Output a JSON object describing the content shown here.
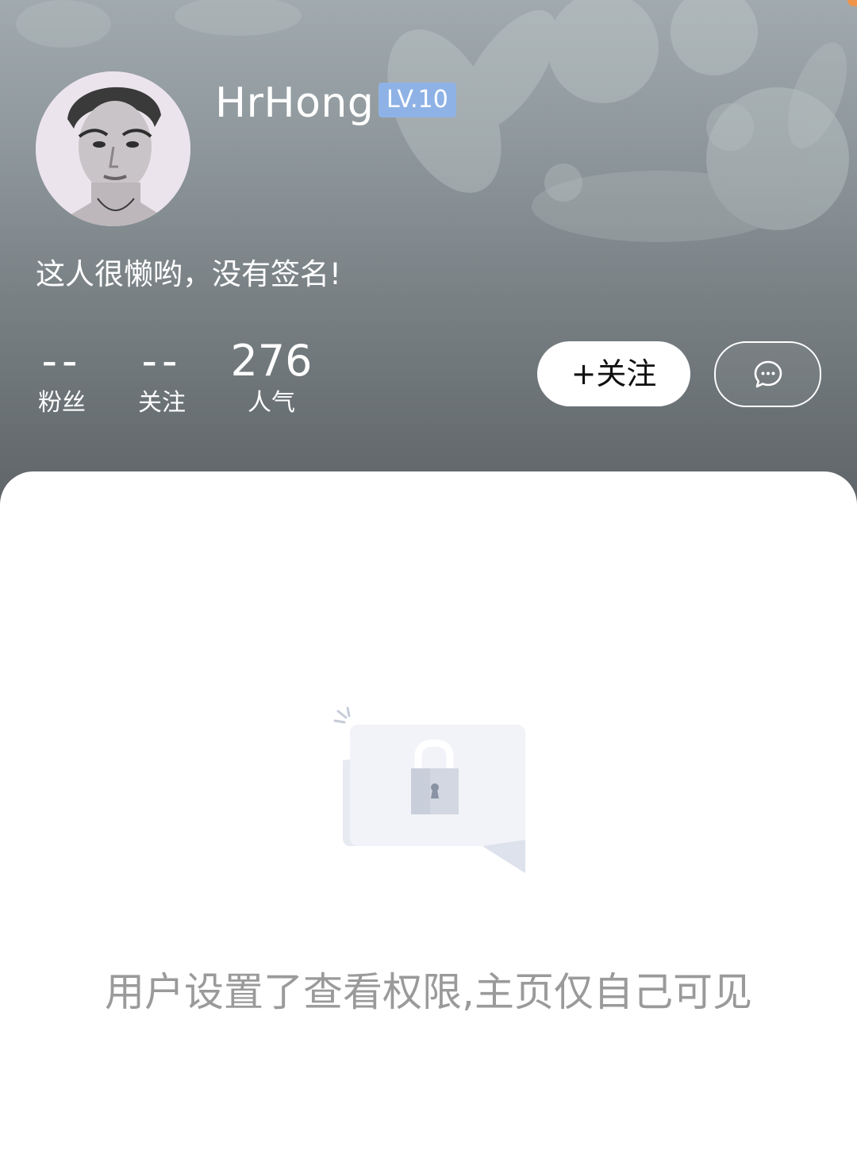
{
  "profile": {
    "username": "HrHong",
    "level": "LV.10",
    "signature": "这人很懒哟，没有签名!"
  },
  "stats": {
    "fans": {
      "value": "--",
      "label": "粉丝"
    },
    "following": {
      "value": "--",
      "label": "关注"
    },
    "popularity": {
      "value": "276",
      "label": "人气"
    }
  },
  "actions": {
    "follow_label": "+关注",
    "message_icon": "chat-bubble-icon"
  },
  "privacy": {
    "message": "用户设置了查看权限,主页仅自己可见",
    "icon": "lock-icon"
  },
  "colors": {
    "level_badge": "#8fb2e6",
    "notice_text": "#9a9a9a",
    "corner_dot": "#f0944a"
  }
}
